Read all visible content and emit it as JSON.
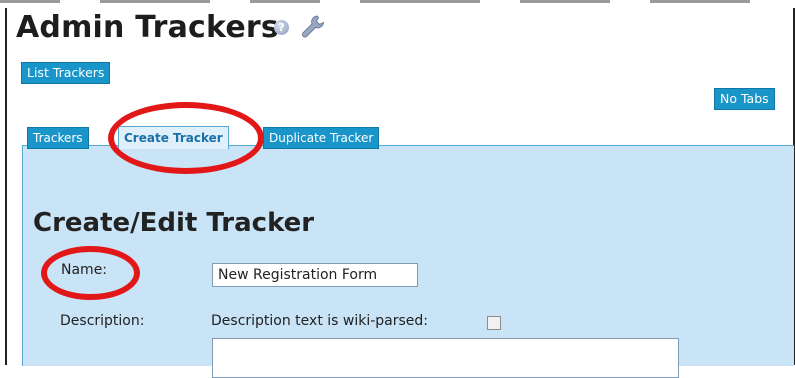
{
  "page": {
    "title": "Admin Trackers",
    "help_icon": "help-icon",
    "settings_icon": "wrench-icon"
  },
  "toolbar": {
    "list_trackers_label": "List Trackers",
    "no_tabs_label": "No Tabs"
  },
  "tabs": [
    {
      "label": "Trackers",
      "active": false
    },
    {
      "label": "Create Tracker",
      "active": true
    },
    {
      "label": "Duplicate Tracker",
      "active": false
    }
  ],
  "form": {
    "heading": "Create/Edit Tracker",
    "name_label": "Name:",
    "name_value": "New Registration Form",
    "description_label": "Description:",
    "description_parse_label": "Description text is wiki-parsed:",
    "description_parse_checked": false,
    "description_value": ""
  },
  "annotations": {
    "color": "#e21818",
    "circled": [
      "Create Tracker",
      "Name:"
    ]
  },
  "colors": {
    "button_bg": "#1a95c9",
    "panel_bg": "#c9e3f7",
    "active_tab_text": "#1a6fa8"
  }
}
